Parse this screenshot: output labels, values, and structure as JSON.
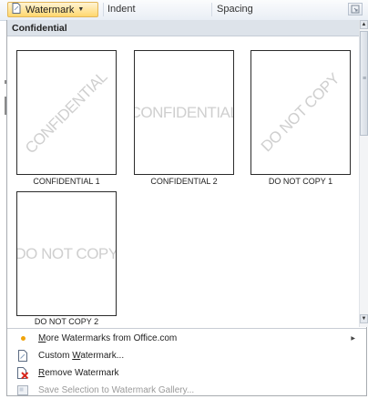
{
  "ribbon": {
    "watermark_button": "Watermark",
    "indent_label": "Indent",
    "spacing_label": "Spacing"
  },
  "gallery": {
    "section_title": "Confidential",
    "items": [
      {
        "caption": "CONFIDENTIAL 1",
        "text": "CONFIDENTIAL",
        "diagonal": true
      },
      {
        "caption": "CONFIDENTIAL 2",
        "text": "CONFIDENTIAL",
        "diagonal": false
      },
      {
        "caption": "DO NOT COPY 1",
        "text": "DO NOT COPY",
        "diagonal": true
      },
      {
        "caption": "DO NOT COPY 2",
        "text": "DO NOT COPY",
        "diagonal": false
      }
    ]
  },
  "menu": {
    "more": {
      "pre": "",
      "key": "M",
      "post": "ore Watermarks from Office.com"
    },
    "custom": {
      "pre": "Custom ",
      "key": "W",
      "post": "atermark..."
    },
    "remove": {
      "pre": "",
      "key": "R",
      "post": "emove Watermark"
    },
    "save": {
      "pre": "Save Selection to Watermark Gallery...",
      "key": "",
      "post": ""
    }
  },
  "colors": {
    "accent": "#ffd76e",
    "header_bg": "#dde3ea",
    "watermark_text": "#cfcfcf",
    "remove_icon": "#d9261c"
  }
}
